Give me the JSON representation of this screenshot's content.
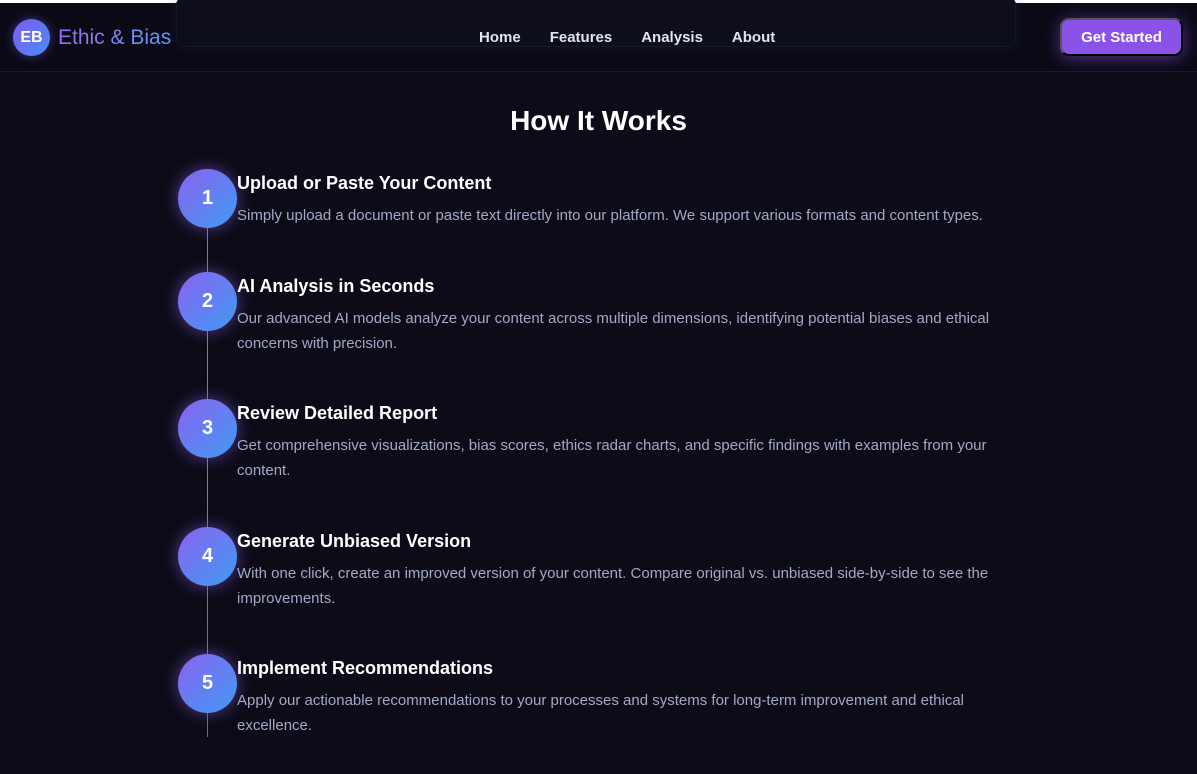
{
  "brand": {
    "mark": "EB",
    "name": "Ethic & Bias"
  },
  "nav": [
    "Home",
    "Features",
    "Analysis",
    "About"
  ],
  "cta": "Get Started",
  "section": {
    "title": "How It Works"
  },
  "steps": [
    {
      "num": "1",
      "title": "Upload or Paste Your Content",
      "desc": "Simply upload a document or paste text directly into our platform. We support various formats and content types."
    },
    {
      "num": "2",
      "title": "AI Analysis in Seconds",
      "desc": "Our advanced AI models analyze your content across multiple dimensions, identifying potential biases and ethical concerns with precision."
    },
    {
      "num": "3",
      "title": "Review Detailed Report",
      "desc": "Get comprehensive visualizations, bias scores, ethics radar charts, and specific findings with examples from your content."
    },
    {
      "num": "4",
      "title": "Generate Unbiased Version",
      "desc": "With one click, create an improved version of your content. Compare original vs. unbiased side-by-side to see the improvements."
    },
    {
      "num": "5",
      "title": "Implement Recommendations",
      "desc": "Apply our actionable recommendations to your processes and systems for long-term improvement and ethical excellence."
    }
  ],
  "colors": {
    "background": "#0c0b17",
    "accent": "#8a52e6",
    "gradient_start": "#8b62f0",
    "gradient_end": "#3f9bf2"
  }
}
